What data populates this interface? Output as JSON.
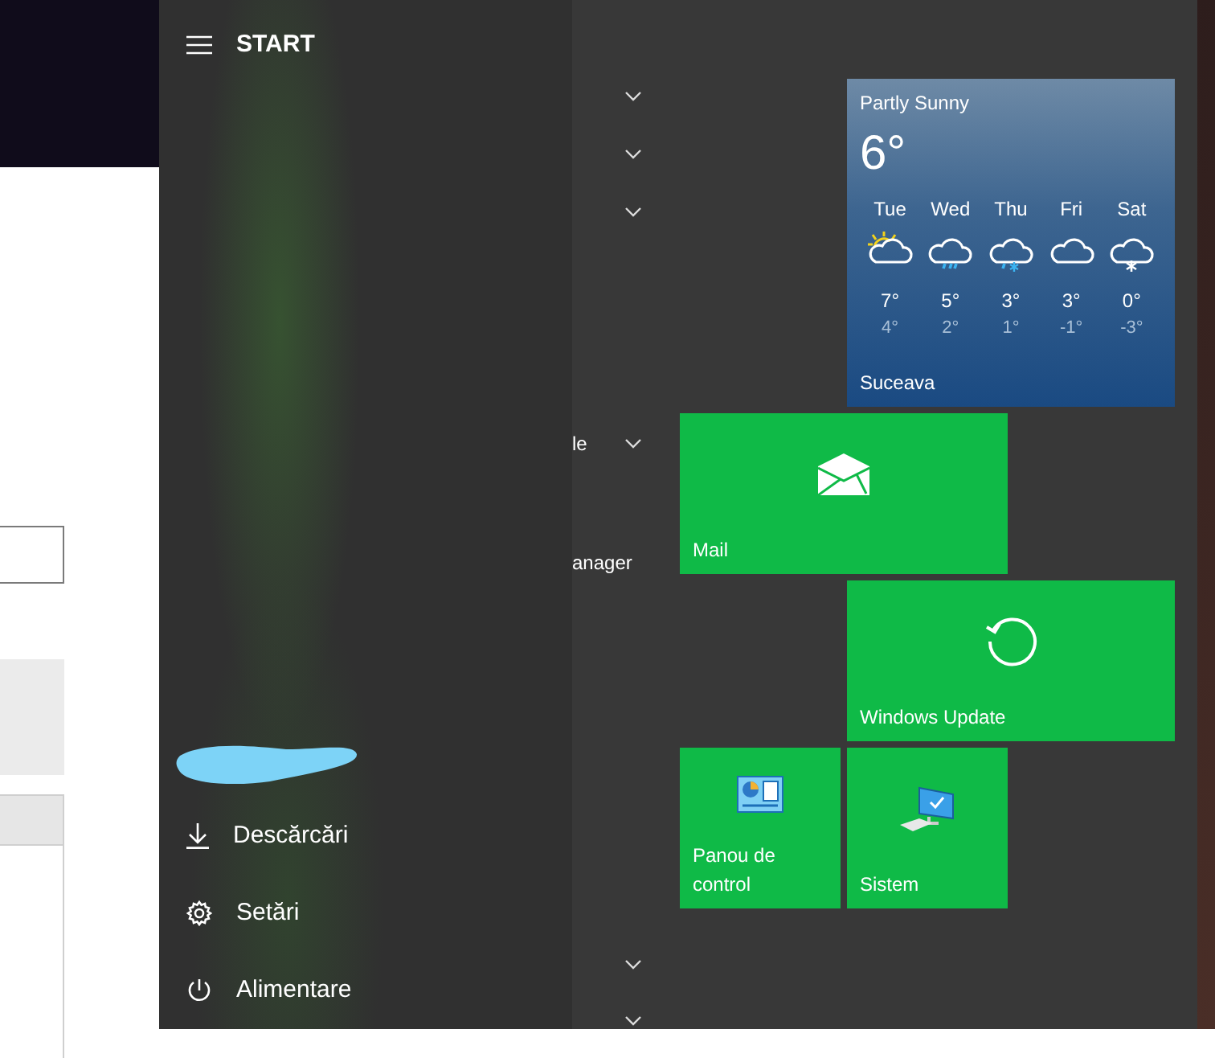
{
  "start_menu": {
    "title": "START",
    "places": [
      {
        "label": "Descărcări",
        "kind": "download"
      },
      {
        "label": "Setări",
        "kind": "settings"
      },
      {
        "label": "Alimentare",
        "kind": "power"
      }
    ],
    "app_list": [
      {
        "expanded": false
      },
      {
        "expanded": false
      },
      {
        "expanded": false
      },
      {
        "label": "le",
        "expanded": false
      },
      {
        "label": "anager"
      },
      {
        "expanded": false
      },
      {
        "expanded": false
      }
    ]
  },
  "weather": {
    "condition": "Partly Sunny",
    "temperature": "6°",
    "location": "Suceava",
    "forecast": [
      {
        "day": "Tue",
        "kind": "partly-sunny",
        "high": "7°",
        "low": "4°"
      },
      {
        "day": "Wed",
        "kind": "rain",
        "high": "5°",
        "low": "2°"
      },
      {
        "day": "Thu",
        "kind": "sleet",
        "high": "3°",
        "low": "1°"
      },
      {
        "day": "Fri",
        "kind": "cloudy",
        "high": "3°",
        "low": "-1°"
      },
      {
        "day": "Sat",
        "kind": "snow",
        "high": "0°",
        "low": "-3°"
      }
    ]
  },
  "tiles": [
    {
      "label": "Mail",
      "kind": "mail"
    },
    {
      "label": "Windows Update",
      "kind": "update"
    },
    {
      "label": "Panou de control",
      "kind": "control-panel"
    },
    {
      "label": "Sistem",
      "kind": "system"
    }
  ]
}
